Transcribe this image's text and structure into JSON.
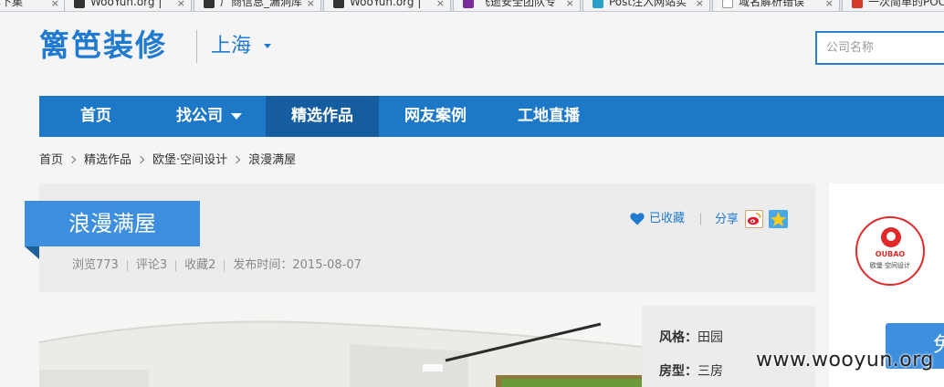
{
  "browser": {
    "tabs": [
      {
        "label": "享下集",
        "favicon_color": "#f0f0f0"
      },
      {
        "label": "WooYun.org |",
        "favicon_color": "#333333"
      },
      {
        "label": "厂商信息_漏洞库",
        "favicon_color": "#333333"
      },
      {
        "label": "WooYun.org |",
        "favicon_color": "#333333"
      },
      {
        "label": "飞逝安全团队专",
        "favicon_color": "#7a2a9a"
      },
      {
        "label": "Post注入网站实",
        "favicon_color": "#2aa0c8"
      },
      {
        "label": "域名解析错误",
        "favicon_color": "#ffffff"
      },
      {
        "label": "一次简单的POC",
        "favicon_color": "#d43a2a"
      }
    ],
    "close_glyph": "×"
  },
  "header": {
    "logo": "篱笆装修",
    "city": "上海",
    "search_placeholder": "公司名称"
  },
  "nav": {
    "items": [
      {
        "label": "首页",
        "active": false
      },
      {
        "label": "找公司",
        "active": false,
        "has_dropdown": true
      },
      {
        "label": "精选作品",
        "active": true
      },
      {
        "label": "网友案例",
        "active": false
      },
      {
        "label": "工地直播",
        "active": false
      }
    ]
  },
  "breadcrumb": [
    "首页",
    "精选作品",
    "欧堡·空间设计",
    "浪漫满屋"
  ],
  "work": {
    "title": "浪漫满屋",
    "views": "浏览773",
    "comments": "评论3",
    "favorites": "收藏2",
    "published": "发布时间：2015-08-07",
    "favorited_label": "已收藏",
    "share_label": "分享",
    "share_icons": [
      "weibo-icon",
      "qzone-icon"
    ]
  },
  "details": [
    {
      "label": "风格：",
      "value": "田园"
    },
    {
      "label": "房型：",
      "value": "三房"
    }
  ],
  "company": {
    "logo_text": "OUBAO",
    "logo_sub": "欧堡·空间设计",
    "button_text": "免"
  },
  "watermark": "www.wooyun.org",
  "colors": {
    "brand_blue": "#1e78c8",
    "active_nav": "#155d9e",
    "ribbon": "#3d8fde"
  }
}
